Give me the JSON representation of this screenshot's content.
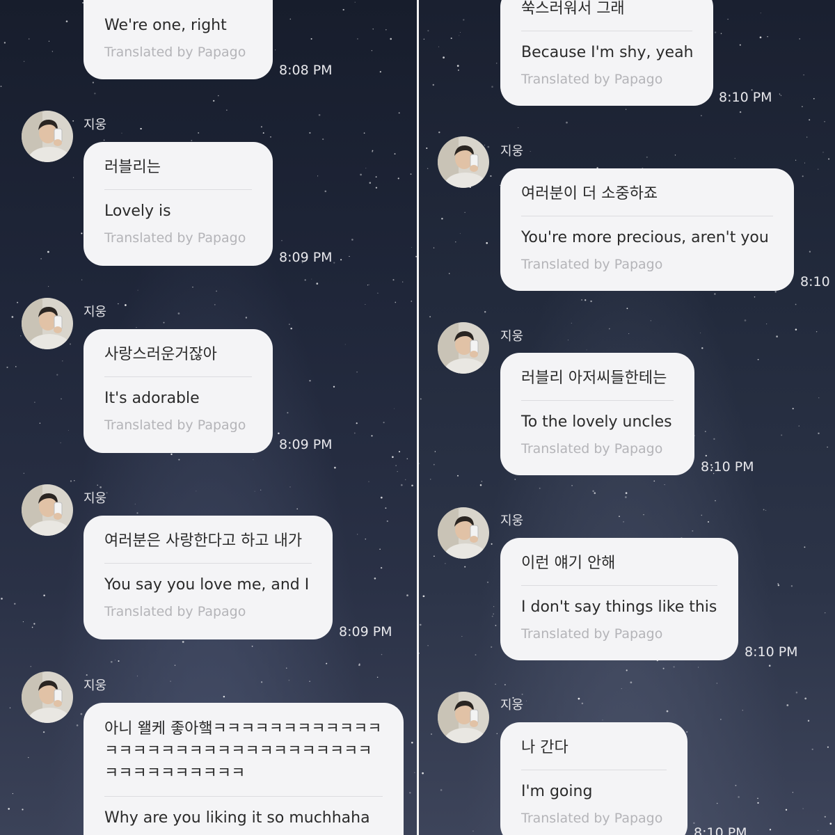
{
  "left": {
    "partial_message": {
      "translation": "We're one, right",
      "credit": "Translated by Papago",
      "time": "8:08 PM"
    },
    "messages": [
      {
        "sender": "지웅",
        "original": "러블리는",
        "translation": "Lovely is",
        "credit": "Translated by Papago",
        "time": "8:09 PM"
      },
      {
        "sender": "지웅",
        "original": "사랑스러운거잖아",
        "translation": "It's adorable",
        "credit": "Translated by Papago",
        "time": "8:09 PM"
      },
      {
        "sender": "지웅",
        "original": "여러분은 사랑한다고 하고 내가",
        "translation": "You say you love me, and I",
        "credit": "Translated by Papago",
        "time": "8:09 PM"
      },
      {
        "sender": "지웅",
        "original": "아니 왤케 좋아햌ㅋㅋㅋㅋㅋㅋㅋㅋㅋㅋㅋㅋㅋㅋㅋㅋㅋㅋㅋㅋㅋㅋㅋㅋㅋㅋㅋㅋㅋㅋㅋㅋㅋㅋㅋㅋㅋㅋㅋㅋㅋ",
        "translation": "Why are you liking it so muchhaha"
      }
    ]
  },
  "right": {
    "partial_message": {
      "original": "쑥스러워서 그래",
      "translation": "Because I'm shy, yeah",
      "credit": "Translated by Papago",
      "time": "8:10 PM"
    },
    "messages": [
      {
        "sender": "지웅",
        "original": "여러분이 더 소중하죠",
        "translation": "You're more precious, aren't you",
        "credit": "Translated by Papago",
        "time": "8:10"
      },
      {
        "sender": "지웅",
        "original": "러블리 아저씨들한테는",
        "translation": "To the lovely uncles",
        "credit": "Translated by Papago",
        "time": "8:10 PM"
      },
      {
        "sender": "지웅",
        "original": "이런 얘기 안해",
        "translation": "I don't say things like this",
        "credit": "Translated by Papago",
        "time": "8:10 PM"
      },
      {
        "sender": "지웅",
        "original": "나 간다",
        "translation": "I'm going",
        "credit": "Translated by Papago",
        "time": "8:10 PM"
      }
    ]
  },
  "colors": {
    "bubble": "#f4f4f6",
    "text": "#2a2a2a",
    "credit": "#b4b4b8",
    "timestamp": "#e8e8ec",
    "sky": "#1e2434"
  },
  "icons": {
    "avatar": "user-avatar-photo",
    "moon": "crescent-moon"
  }
}
